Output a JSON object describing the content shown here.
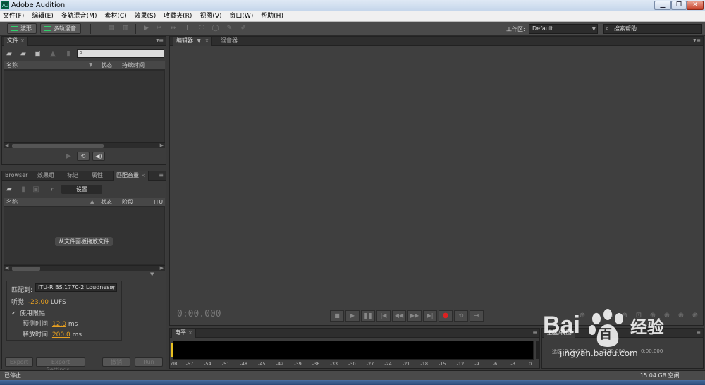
{
  "window": {
    "title": "Adobe Audition",
    "app_icon": "Au"
  },
  "menu": [
    "文件(F)",
    "编辑(E)",
    "多轨混音(M)",
    "素材(C)",
    "效果(S)",
    "收藏夹(R)",
    "视图(V)",
    "窗口(W)",
    "帮助(H)"
  ],
  "toolbar": {
    "waveform_label": "波形",
    "multitrack_label": "多轨混音",
    "workspace_label": "工作区:",
    "workspace_value": "Default",
    "help_search_placeholder": "搜索帮助"
  },
  "files_panel": {
    "tab": "文件",
    "columns": {
      "name": "名称",
      "status": "状态",
      "duration": "持续时间"
    }
  },
  "match_panel": {
    "tabs": [
      "Browser",
      "效果组",
      "标记",
      "属性",
      "匹配音量"
    ],
    "settings_button": "设置",
    "columns": {
      "name": "名称",
      "status": "状态",
      "stage": "阶段",
      "itu": "ITU"
    },
    "drop_hint": "从文件面板拖放文件",
    "match_to_label": "匹配到:",
    "match_to_value": "ITU-R BS.1770-2 Loudness",
    "loudness_label": "听觉:",
    "loudness_value": "-23.00",
    "loudness_unit": "LUFS",
    "use_limit_label": "使用限幅",
    "lookahead_label": "预测时间:",
    "lookahead_value": "12.0",
    "lookahead_unit": "ms",
    "release_label": "释放时间:",
    "release_value": "200.0",
    "release_unit": "ms",
    "export_button": "Export",
    "export_settings_button": "Export Settings...",
    "cancel_button": "撤销",
    "run_button": "Run"
  },
  "editor_panel": {
    "tabs": [
      "编辑器",
      "混音器"
    ],
    "timecode": "0:00.000"
  },
  "level_panel": {
    "tab": "电平",
    "scale": [
      "dB",
      "-57",
      "-54",
      "-51",
      "-48",
      "-45",
      "-42",
      "-39",
      "-36",
      "-33",
      "-30",
      "-27",
      "-24",
      "-21",
      "-18",
      "-15",
      "-12",
      "-9",
      "-6",
      "-3",
      "0"
    ]
  },
  "selection_panel": {
    "tab": "选区/视图",
    "row_label": "选区",
    "values": [
      "0:00.000",
      "0:00.000",
      "0:00.000"
    ]
  },
  "status": {
    "left": "已停止",
    "disk_free": "15.04 GB 空闲"
  },
  "watermark": {
    "brand": "Bai",
    "brand2": "百",
    "site": "jingyan.baidu.com",
    "cn": "经验"
  }
}
